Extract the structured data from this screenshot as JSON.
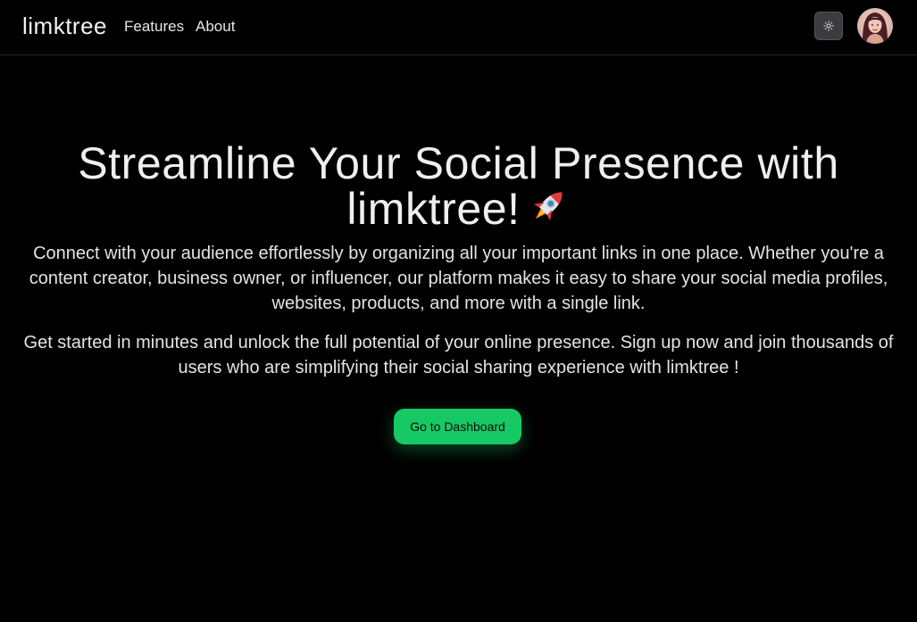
{
  "navbar": {
    "brand": "limktree",
    "links": [
      "Features",
      "About"
    ],
    "theme_toggle_icon": "sun-icon",
    "avatar_icon": "user-avatar"
  },
  "hero": {
    "title": "Streamline Your Social Presence with limktree!",
    "title_emoji_icon": "rocket-icon",
    "description_1": "Connect with your audience effortlessly by organizing all your important links in one place. Whether you're a content creator, business owner, or influencer, our platform makes it easy to share your social media profiles, websites, products, and more with a single link.",
    "description_2": "Get started in minutes and unlock the full potential of your online presence. Sign up now and join thousands of users who are simplifying their social sharing experience with limktree !",
    "cta_label": "Go to Dashboard"
  },
  "colors": {
    "background": "#000000",
    "accent": "#17c964",
    "text": "#ececec"
  }
}
